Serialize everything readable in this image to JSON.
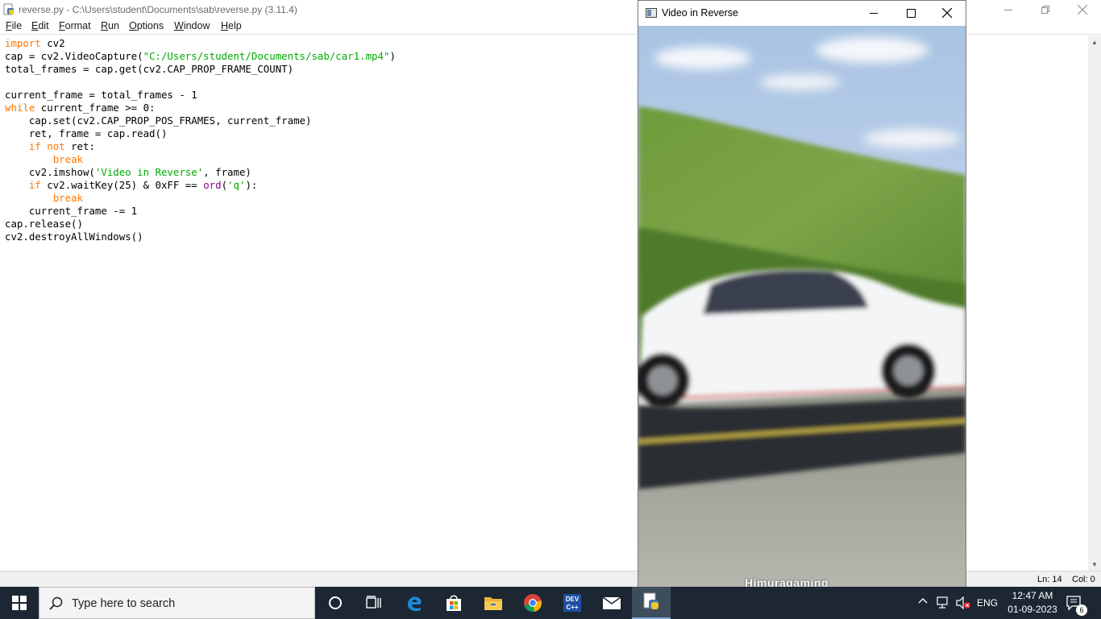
{
  "idle": {
    "title": "reverse.py - C:\\Users\\student\\Documents\\sab\\reverse.py (3.11.4)",
    "menu": [
      {
        "label": "File"
      },
      {
        "label": "Edit"
      },
      {
        "label": "Format"
      },
      {
        "label": "Run"
      },
      {
        "label": "Options"
      },
      {
        "label": "Window"
      },
      {
        "label": "Help"
      }
    ],
    "code_lines": [
      "import cv2",
      "cap = cv2.VideoCapture(\"C:/Users/student/Documents/sab/car1.mp4\")",
      "total_frames = cap.get(cv2.CAP_PROP_FRAME_COUNT)",
      "",
      "current_frame = total_frames - 1",
      "while current_frame >= 0:",
      "    cap.set(cv2.CAP_PROP_POS_FRAMES, current_frame)",
      "    ret, frame = cap.read()",
      "    if not ret:",
      "        break",
      "    cv2.imshow('Video in Reverse', frame)",
      "    if cv2.waitKey(25) & 0xFF == ord('q'):",
      "        break",
      "    current_frame -= 1",
      "cap.release()",
      "cv2.destroyAllWindows()"
    ],
    "status": {
      "line": "Ln: 14",
      "col": "Col: 0"
    }
  },
  "video_window": {
    "title": "Video in Reverse",
    "watermark": "Himuragaming"
  },
  "taskbar": {
    "search_placeholder": "Type here to search",
    "apps": [
      {
        "icon": "cortana-icon"
      },
      {
        "icon": "task-view-icon"
      },
      {
        "icon": "edge-icon"
      },
      {
        "icon": "store-icon"
      },
      {
        "icon": "file-explorer-icon"
      },
      {
        "icon": "chrome-icon"
      },
      {
        "icon": "devcpp-icon"
      },
      {
        "icon": "mail-icon"
      },
      {
        "icon": "python-idle-icon"
      }
    ],
    "tray": {
      "language": "ENG",
      "time": "12:47 AM",
      "date": "01-09-2023",
      "notifications": "6"
    }
  },
  "colors": {
    "keyword": "#ff7700",
    "string": "#00aa00",
    "builtin": "#900090",
    "taskbar": "#1c2733"
  }
}
